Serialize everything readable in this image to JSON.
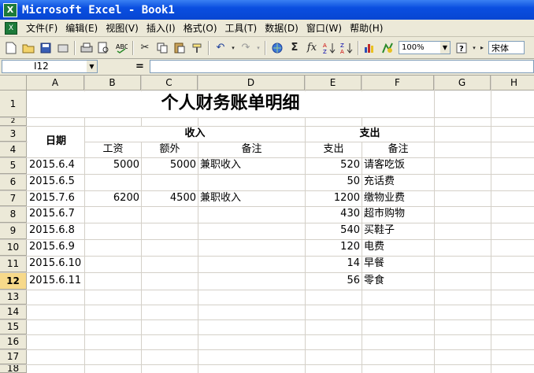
{
  "window": {
    "title": "Microsoft Excel - Book1"
  },
  "menu": [
    "文件(F)",
    "编辑(E)",
    "视图(V)",
    "插入(I)",
    "格式(O)",
    "工具(T)",
    "数据(D)",
    "窗口(W)",
    "帮助(H)"
  ],
  "toolbar": {
    "zoom": "100%",
    "font": "宋体"
  },
  "formula_bar": {
    "name_box": "I12",
    "eq": "=",
    "value": ""
  },
  "columns": [
    "A",
    "B",
    "C",
    "D",
    "E",
    "F",
    "G",
    "H"
  ],
  "rows": [
    "1",
    "2",
    "3",
    "4",
    "5",
    "6",
    "7",
    "8",
    "9",
    "10",
    "11",
    "12",
    "13",
    "14",
    "15",
    "16",
    "17",
    "18"
  ],
  "sheet": {
    "title": "个人财务账单明细",
    "date_header": "日期",
    "income_header": "收入",
    "expense_header": "支出",
    "sub_salary": "工资",
    "sub_extra": "额外",
    "sub_note": "备注",
    "sub_expense": "支出",
    "sub_expense_note": "备注",
    "records": [
      {
        "date": "2015.6.4",
        "salary": "5000",
        "extra": "5000",
        "note": "兼职收入",
        "expense": "520",
        "expense_note": "请客吃饭"
      },
      {
        "date": "2015.6.5",
        "salary": "",
        "extra": "",
        "note": "",
        "expense": "50",
        "expense_note": "充话费"
      },
      {
        "date": "2015.7.6",
        "salary": "6200",
        "extra": "4500",
        "note": "兼职收入",
        "expense": "1200",
        "expense_note": "缴物业费"
      },
      {
        "date": "2015.6.7",
        "salary": "",
        "extra": "",
        "note": "",
        "expense": "430",
        "expense_note": "超市购物"
      },
      {
        "date": "2015.6.8",
        "salary": "",
        "extra": "",
        "note": "",
        "expense": "540",
        "expense_note": "买鞋子"
      },
      {
        "date": "2015.6.9",
        "salary": "",
        "extra": "",
        "note": "",
        "expense": "120",
        "expense_note": "电费"
      },
      {
        "date": "2015.6.10",
        "salary": "",
        "extra": "",
        "note": "",
        "expense": "14",
        "expense_note": "早餐"
      },
      {
        "date": "2015.6.11",
        "salary": "",
        "extra": "",
        "note": "",
        "expense": "56",
        "expense_note": "零食"
      }
    ]
  }
}
